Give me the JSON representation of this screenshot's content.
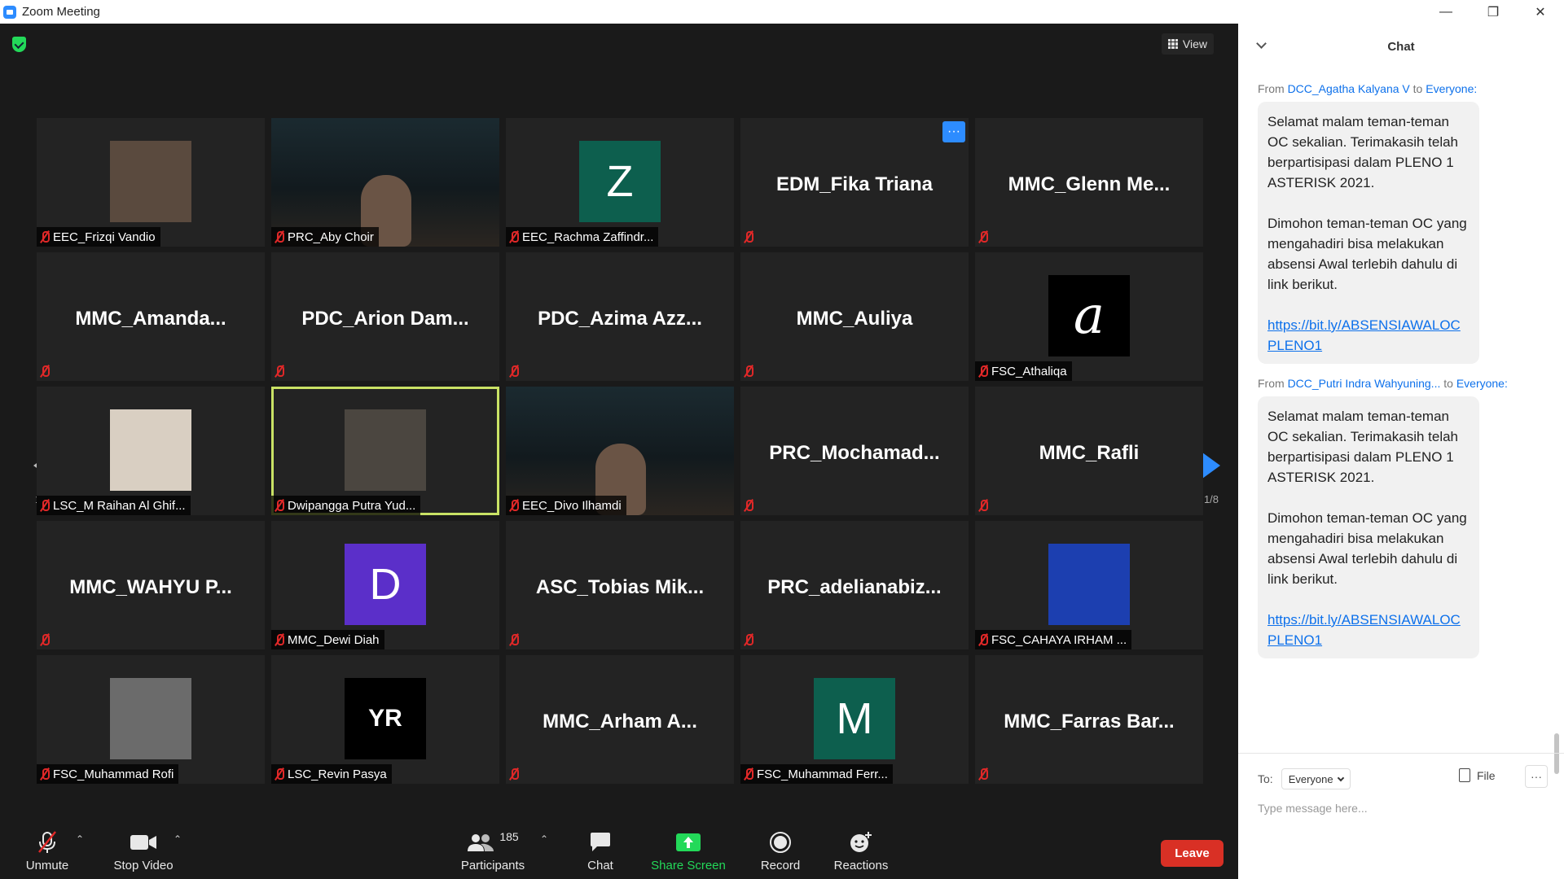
{
  "window": {
    "title": "Zoom Meeting",
    "controls": [
      "—",
      "❐",
      "✕"
    ]
  },
  "meeting": {
    "view_label": "View",
    "page_indicator": "1/8",
    "tiles": [
      {
        "name": "EEC_Frizqi Vandio",
        "kind": "photo",
        "avatar_color": "#5a4a3e"
      },
      {
        "name": "PRC_Aby Choir",
        "kind": "video"
      },
      {
        "name": "EEC_Rachma Zaffindr...",
        "kind": "letter",
        "letter": "Z",
        "avatar_color": "#0d5f4e"
      },
      {
        "name": "EDM_Fika Triana",
        "kind": "bigname",
        "has_more": true
      },
      {
        "name": "MMC_Glenn  Me...",
        "kind": "bigname"
      },
      {
        "name": "MMC_Amanda...",
        "kind": "bigname"
      },
      {
        "name": "PDC_Arion  Dam...",
        "kind": "bigname"
      },
      {
        "name": "PDC_Azima  Azz...",
        "kind": "bigname"
      },
      {
        "name": "MMC_Auliya",
        "kind": "bigname"
      },
      {
        "name": "FSC_Athaliqa",
        "kind": "letter",
        "letter": "a",
        "avatar_color": "#000000"
      },
      {
        "name": "LSC_M Raihan Al Ghif...",
        "kind": "photo",
        "avatar_color": "#d9cfc2"
      },
      {
        "name": "Dwipangga Putra Yud...",
        "kind": "photo",
        "avatar_color": "#4b4640",
        "speaking": true
      },
      {
        "name": "EEC_Divo Ilhamdi",
        "kind": "video"
      },
      {
        "name": "PRC_Mochamad...",
        "kind": "bigname"
      },
      {
        "name": "MMC_Rafli",
        "kind": "bigname"
      },
      {
        "name": "MMC_WAHYU  P...",
        "kind": "bigname"
      },
      {
        "name": "MMC_Dewi Diah",
        "kind": "letter",
        "letter": "D",
        "avatar_color": "#5b2fc9"
      },
      {
        "name": "ASC_Tobias  Mik...",
        "kind": "bigname"
      },
      {
        "name": "PRC_adelianabiz...",
        "kind": "bigname"
      },
      {
        "name": "FSC_CAHAYA IRHAM ...",
        "kind": "photo",
        "avatar_color": "#1c3fb0"
      },
      {
        "name": "FSC_Muhammad Rofi",
        "kind": "photo",
        "avatar_color": "#6b6b6b"
      },
      {
        "name": "LSC_Revin Pasya",
        "kind": "letter",
        "letter": "YR",
        "avatar_color": "#000000"
      },
      {
        "name": "MMC_Arham  A...",
        "kind": "bigname"
      },
      {
        "name": "FSC_Muhammad Ferr...",
        "kind": "letter",
        "letter": "M",
        "avatar_color": "#0d5f4e"
      },
      {
        "name": "MMC_Farras  Bar...",
        "kind": "bigname"
      }
    ]
  },
  "toolbar": {
    "unmute": "Unmute",
    "stop_video": "Stop Video",
    "participants": "Participants",
    "participant_count": "185",
    "chat": "Chat",
    "share_screen": "Share Screen",
    "record": "Record",
    "reactions": "Reactions",
    "leave": "Leave"
  },
  "chat": {
    "title": "Chat",
    "messages": [
      {
        "from_prefix": "From",
        "sender": "DCC_Agatha Kalyana V",
        "to_word": "to",
        "recipient": "Everyone:",
        "para1": "Selamat malam teman-teman OC sekalian. Terimakasih telah berpartisipasi dalam PLENO 1 ASTERISK 2021.",
        "para2": "Dimohon teman-teman OC yang mengahadiri bisa melakukan absensi Awal terlebih dahulu di link berikut.",
        "link": "https://bit.ly/ABSENSIAWALOCPLENO1"
      },
      {
        "from_prefix": "From",
        "sender": "DCC_Putri Indra Wahyuning...",
        "to_word": "to",
        "recipient": "Everyone:",
        "para1": "Selamat malam teman-teman OC sekalian. Terimakasih telah berpartisipasi dalam PLENO 1 ASTERISK 2021.",
        "para2": "Dimohon teman-teman OC yang mengahadiri bisa melakukan absensi Awal terlebih dahulu di link berikut.",
        "link": "https://bit.ly/ABSENSIAWALOCPLENO1"
      }
    ],
    "to_label": "To:",
    "to_value": "Everyone",
    "file_label": "File",
    "more_label": "···",
    "input_placeholder": "Type message here..."
  },
  "colors": {
    "accent": "#2d8cff",
    "share_green": "#23d959",
    "leave_red": "#d93025",
    "speaking_outline": "#c9e265",
    "mute_red": "#e02828"
  }
}
